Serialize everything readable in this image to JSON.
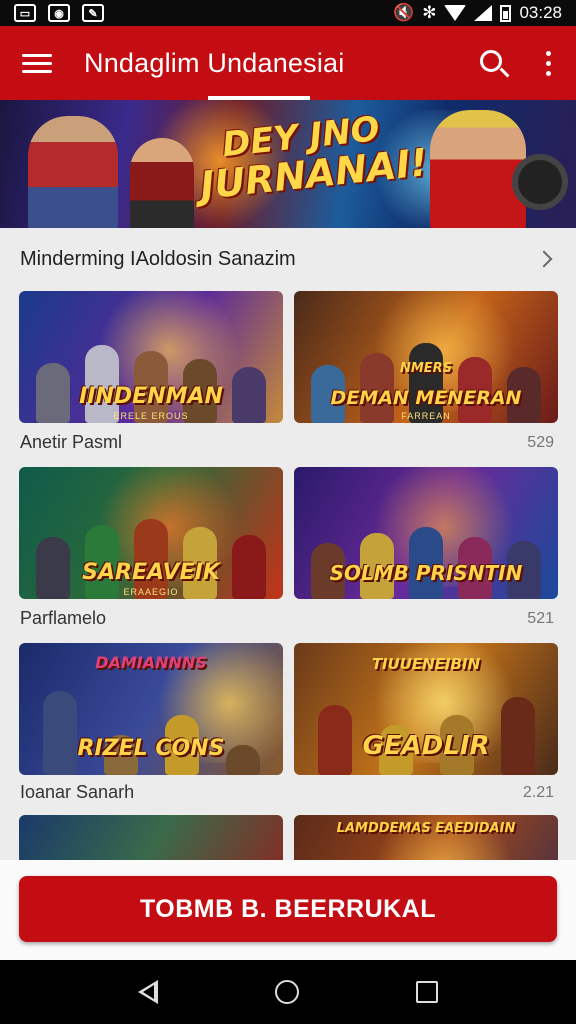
{
  "status_bar": {
    "time": "03:28",
    "icons": [
      "gallery-icon",
      "image-icon",
      "edit-icon",
      "mute-icon",
      "settings-icon",
      "wifi-icon",
      "signal-icon",
      "battery-icon"
    ]
  },
  "app_bar": {
    "title": "Nndaglim Undanesiai",
    "color": "#c30d12",
    "icons": [
      "menu-icon",
      "search-icon",
      "more-vert-icon"
    ]
  },
  "hero": {
    "title_line1": "DEY JNO",
    "title_line2": "JURNANAI!"
  },
  "section": {
    "title": "Minderming IAoldosin Sanazim"
  },
  "rows": [
    {
      "label": "Anetir Pasml",
      "count": "529",
      "cards": [
        {
          "title": "IINDENMAN",
          "subtitle": "ERELE EROUS"
        },
        {
          "title": "DEMAN MENERAN",
          "top": "NMERS",
          "subtitle": "FARREAN"
        }
      ]
    },
    {
      "label": "Parflamelo",
      "count": "521",
      "cards": [
        {
          "title": "SAREAVEIK",
          "subtitle": "ERAAEGIO"
        },
        {
          "title": "SOLMB PRISNTIN",
          "subtitle": ""
        }
      ]
    },
    {
      "label": "Ioanar Sanarh",
      "count": "2.21",
      "cards": [
        {
          "title": "RIZEL CONS",
          "top": "DAMIANNNS",
          "subtitle": ""
        },
        {
          "title": "GEADLIR",
          "top": "TIUUENEIBIN",
          "subtitle": ""
        }
      ]
    },
    {
      "label": "",
      "count": "",
      "cards": [
        {
          "title": "",
          "subtitle": ""
        },
        {
          "title": "",
          "top": "LAMDDEMAS EAEDIDAIN",
          "subtitle": ""
        }
      ]
    }
  ],
  "cta": {
    "label": "TOBMB B. BEERRUKAL"
  },
  "nav": {
    "icons": [
      "back-icon",
      "home-icon",
      "recents-icon"
    ]
  }
}
